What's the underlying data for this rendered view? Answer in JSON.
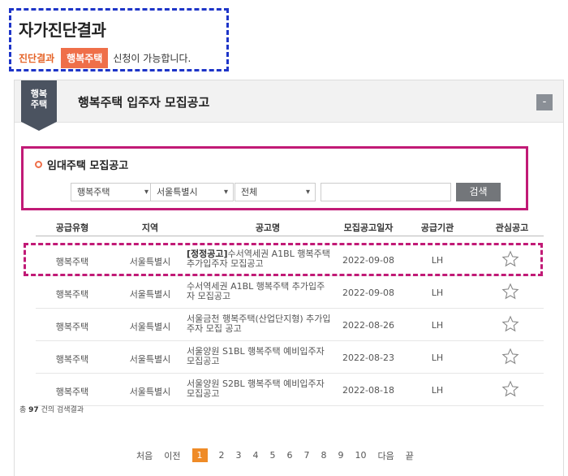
{
  "result": {
    "title": "자가진단결과",
    "label": "진단결과",
    "badge": "행복주택",
    "message": "신청이 가능합니다."
  },
  "panel": {
    "ribbon_label": "행복\n주택",
    "title": "행복주택 입주자 모집공고",
    "collapse_symbol": "-"
  },
  "search": {
    "title": "임대주택 모집공고",
    "select_type": "행복주택",
    "select_region": "서울특별시",
    "select_status": "전체",
    "input_value": "",
    "button_label": "검색"
  },
  "table": {
    "headers": [
      "공급유형",
      "지역",
      "공고명",
      "모집공고일자",
      "공급기관",
      "관심공고"
    ],
    "rows": [
      {
        "type": "행복주택",
        "region": "서울특별시",
        "prefix": "[정정공고]",
        "title": "수서역세권 A1BL 행복주택 추가입주자 모집공고",
        "date": "2022-09-08",
        "agency": "LH"
      },
      {
        "type": "행복주택",
        "region": "서울특별시",
        "prefix": "",
        "title": "수서역세권 A1BL 행복주택 추가입주자 모집공고",
        "date": "2022-09-08",
        "agency": "LH"
      },
      {
        "type": "행복주택",
        "region": "서울특별시",
        "prefix": "",
        "title": "서울금천 행복주택(산업단지형) 추가입주자 모집 공고",
        "date": "2022-08-26",
        "agency": "LH"
      },
      {
        "type": "행복주택",
        "region": "서울특별시",
        "prefix": "",
        "title": "서울양원 S1BL 행복주택 예비입주자 모집공고",
        "date": "2022-08-23",
        "agency": "LH"
      },
      {
        "type": "행복주택",
        "region": "서울특별시",
        "prefix": "",
        "title": "서울양원 S2BL 행복주택 예비입주자 모집공고",
        "date": "2022-08-18",
        "agency": "LH"
      }
    ]
  },
  "total": {
    "prefix": "총",
    "count": "97",
    "suffix": "건의 검색결과"
  },
  "pagination": {
    "first": "처음",
    "prev": "이전",
    "current": "1",
    "pages": [
      "2",
      "3",
      "4",
      "5",
      "6",
      "7",
      "8",
      "9",
      "10"
    ],
    "next": "다음",
    "last": "끝"
  },
  "colors": {
    "accent": "#ef6f49",
    "highlight_border": "#c11a76",
    "result_border": "#1e35c8",
    "pager_current": "#ef8b27"
  }
}
